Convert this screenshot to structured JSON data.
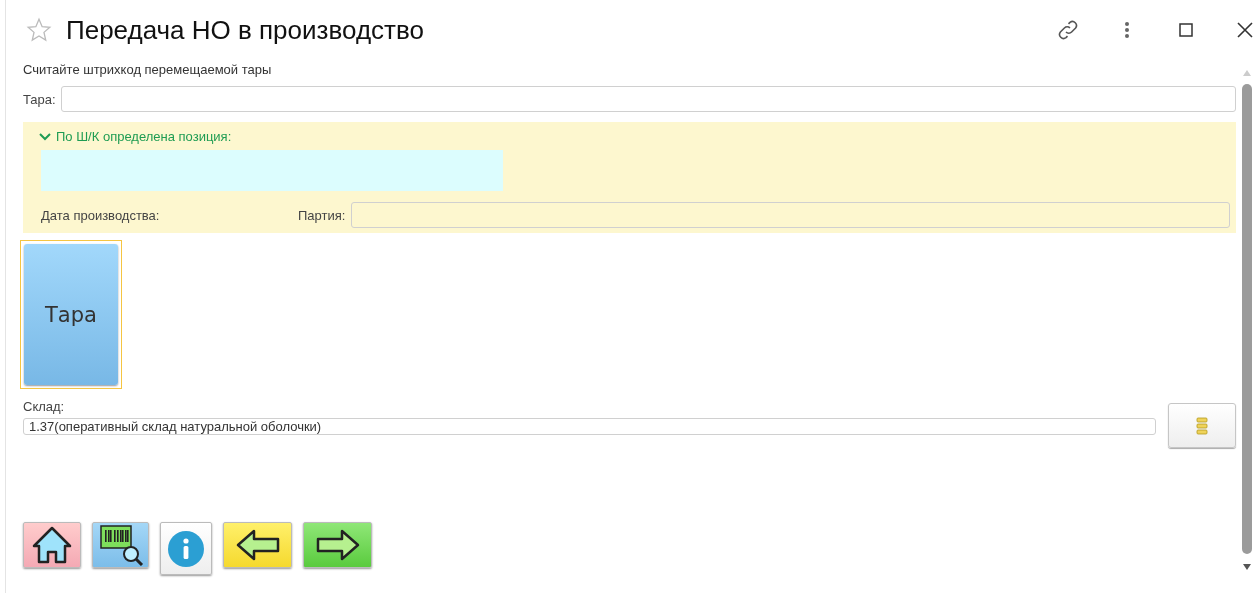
{
  "window": {
    "title": "Передача НО в производство",
    "favorite": false
  },
  "instruction": "Считайте штрихкод перемещаемой тары",
  "tara_field": {
    "label": "Тара:"
  },
  "position_group": {
    "title": "По Ш/К определена позиция:",
    "expanded": true,
    "date_label": "Дата производства:",
    "party_label": "Партия:"
  },
  "tile": {
    "label": "Тара",
    "selected": true
  },
  "warehouse": {
    "label": "Склад:",
    "value": "1.37(оперативный склад натуральной оболочки)"
  },
  "toolbar": [
    {
      "kind": "home"
    },
    {
      "kind": "barcode"
    },
    {
      "kind": "info"
    },
    {
      "kind": "back"
    },
    {
      "kind": "forward"
    }
  ]
}
